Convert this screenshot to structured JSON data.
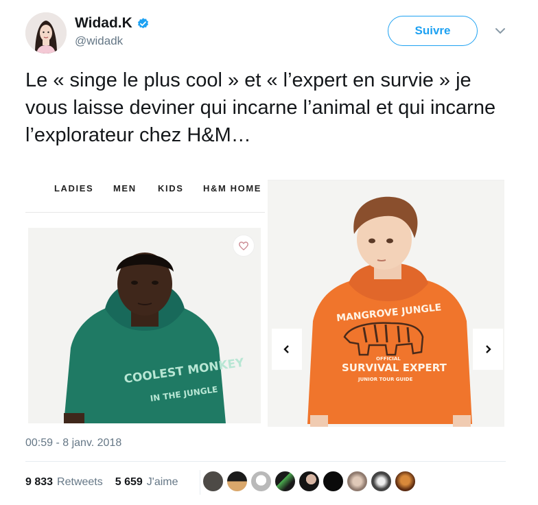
{
  "author": {
    "display_name": "Widad.K",
    "handle": "@widadk",
    "verified": true
  },
  "follow_label": "Suivre",
  "tweet_text": "Le « singe le plus cool » et « l’expert en survie » je vous laisse deviner qui incarne l’animal et qui incarne  l’explorateur chez H&M…",
  "media": {
    "nav_items": [
      "LADIES",
      "MEN",
      "KIDS",
      "H&M HOME"
    ],
    "left_shirt_text": [
      "COOLEST MONKEY",
      "IN THE JUNGLE"
    ],
    "right_shirt_text": [
      "MANGROVE JUNGLE",
      "OFFICIAL",
      "SURVIVAL EXPERT",
      "JUNIOR TOUR GUIDE"
    ]
  },
  "timestamp": "00:59 - 8 janv. 2018",
  "stats": {
    "retweets_count": "9 833",
    "retweets_label": "Retweets",
    "likes_count": "5 659",
    "likes_label": "J'aime"
  },
  "colors": {
    "accent": "#1da1f2",
    "text": "#14171a",
    "secondary": "#657786",
    "hoodie_green": "#1f7a64",
    "hoodie_orange": "#f0752c"
  },
  "likers": [
    "liker-avatar-1",
    "liker-avatar-2",
    "liker-avatar-3",
    "liker-avatar-4",
    "liker-avatar-5",
    "liker-avatar-6",
    "liker-avatar-7",
    "liker-avatar-8",
    "liker-avatar-9"
  ]
}
